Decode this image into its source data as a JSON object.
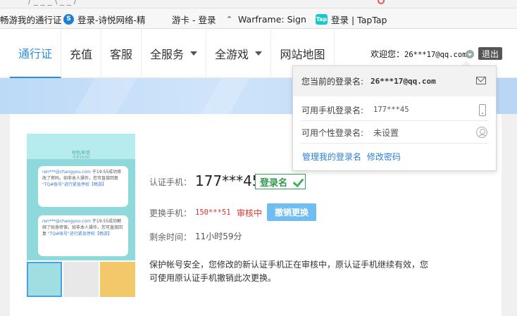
{
  "browser": {
    "top_strip_text": "/ _ _ _ \\ _ _ /",
    "bookmarks": [
      {
        "label": "畅游我的通行证",
        "icon": "page-icon"
      },
      {
        "label": "登录-诗悦网络-精",
        "icon": "shield-s-icon"
      },
      {
        "label": "游卡 - 登录",
        "icon": "blank-icon"
      },
      {
        "label": "Warframe: Sign",
        "icon": "warframe-icon"
      },
      {
        "label": "登录 | TapTap",
        "icon": "taptap-icon"
      }
    ],
    "taptap_badge": "Tap"
  },
  "nav": {
    "items": [
      {
        "label": "通行证",
        "active": true
      },
      {
        "label": "充值",
        "active": false
      },
      {
        "label": "客服",
        "active": false
      },
      {
        "label": "全服务",
        "active": false,
        "dropdown": true
      },
      {
        "label": "全游戏",
        "active": false,
        "dropdown": true
      },
      {
        "label": "网站地图",
        "active": false
      }
    ],
    "welcome_label": "欢迎您：",
    "welcome_user": "26***17@qq.com",
    "logout_label": "退出"
  },
  "dropdown": {
    "current_login_label": "您当前的登录名:",
    "current_login_value": "26***17@qq.com",
    "mobile_login_label": "可用手机登录名:",
    "mobile_login_value": "177***45",
    "custom_login_label": "可用个性登录名:",
    "custom_login_value": "未设置",
    "manage_link": "管理我的登录名",
    "change_password_link": "修改密码"
  },
  "phone_image": {
    "header_title": "短信/彩信",
    "header_time": "今天19:50",
    "messages": [
      {
        "sender": "ren***@changyou.com",
        "lines": [
          "于19:55成功修改了密码。如非本人操作，您可直接回复",
          "\"TQ#账号\"进行紧急停权【畅游】"
        ]
      },
      {
        "sender": "ren***@changyou.com",
        "lines": [
          "于19:55成功解绑了贴身密保。如非本人操作，您可直接回复",
          "\"TQ#账号\"进行紧急停权【畅游】"
        ]
      }
    ]
  },
  "account": {
    "auth_phone_label": "认证手机：",
    "auth_phone_value": "177***45",
    "login_badge_label": "登录名",
    "change_phone_label": "更换手机：",
    "new_phone_value": "150***51",
    "review_status": "审核中",
    "cancel_button": "撤销更换",
    "remaining_label": "剩余时间：",
    "remaining_value": "11小时59分",
    "notice": "保护帐号安全，您修改的新认证手机正在审核中，原认证手机继续有效，您可使用原认证手机撤销此次更换。"
  },
  "colors": {
    "accent": "#2c8ee0",
    "success": "#2e9a4c",
    "danger": "#e03030",
    "button": "#70bdf2"
  }
}
